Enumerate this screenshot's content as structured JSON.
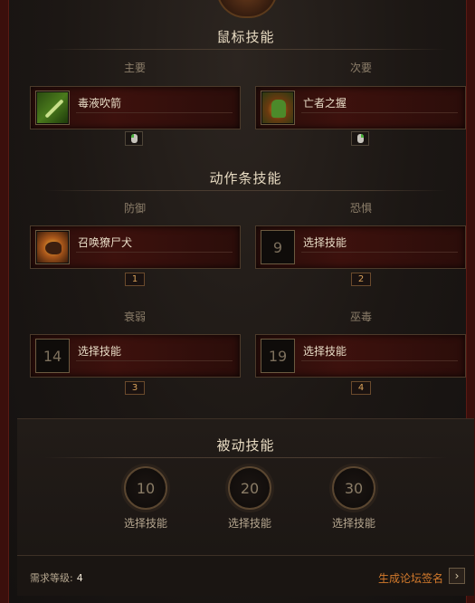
{
  "sections": {
    "mouse": {
      "title": "鼠标技能"
    },
    "action": {
      "title": "动作条技能"
    },
    "passive": {
      "title": "被动技能"
    }
  },
  "mouse_slots": [
    {
      "label": "主要",
      "skill": "毒液吹箭",
      "icon": "poison-dart-icon",
      "mouse": "left-mouse-icon"
    },
    {
      "label": "次要",
      "skill": "亡者之握",
      "icon": "grasp-of-the-dead-icon",
      "mouse": "right-mouse-icon"
    }
  ],
  "action_slots": [
    {
      "label": "防御",
      "skill": "召唤獠尸犬",
      "icon": "summon-zombie-dogs-icon",
      "level": "",
      "key": "1"
    },
    {
      "label": "恐惧",
      "skill": "选择技能",
      "level": "9",
      "key": "2"
    },
    {
      "label": "衰弱",
      "skill": "选择技能",
      "level": "14",
      "key": "3"
    },
    {
      "label": "巫毒",
      "skill": "选择技能",
      "level": "19",
      "key": "4"
    }
  ],
  "passive_slots": [
    {
      "level": "10",
      "label": "选择技能"
    },
    {
      "level": "20",
      "label": "选择技能"
    },
    {
      "level": "30",
      "label": "选择技能"
    }
  ],
  "footer": {
    "required_level_label": "需求等级:",
    "required_level_value": "4",
    "signature_link": "生成论坛签名",
    "signature_button_icon": "chevron-right-icon"
  },
  "colors": {
    "accent": "#d47a2c",
    "slot_bg": "#3d110d",
    "key_badge_text": "#d8a15a",
    "border_red": "#3b0f0c"
  }
}
